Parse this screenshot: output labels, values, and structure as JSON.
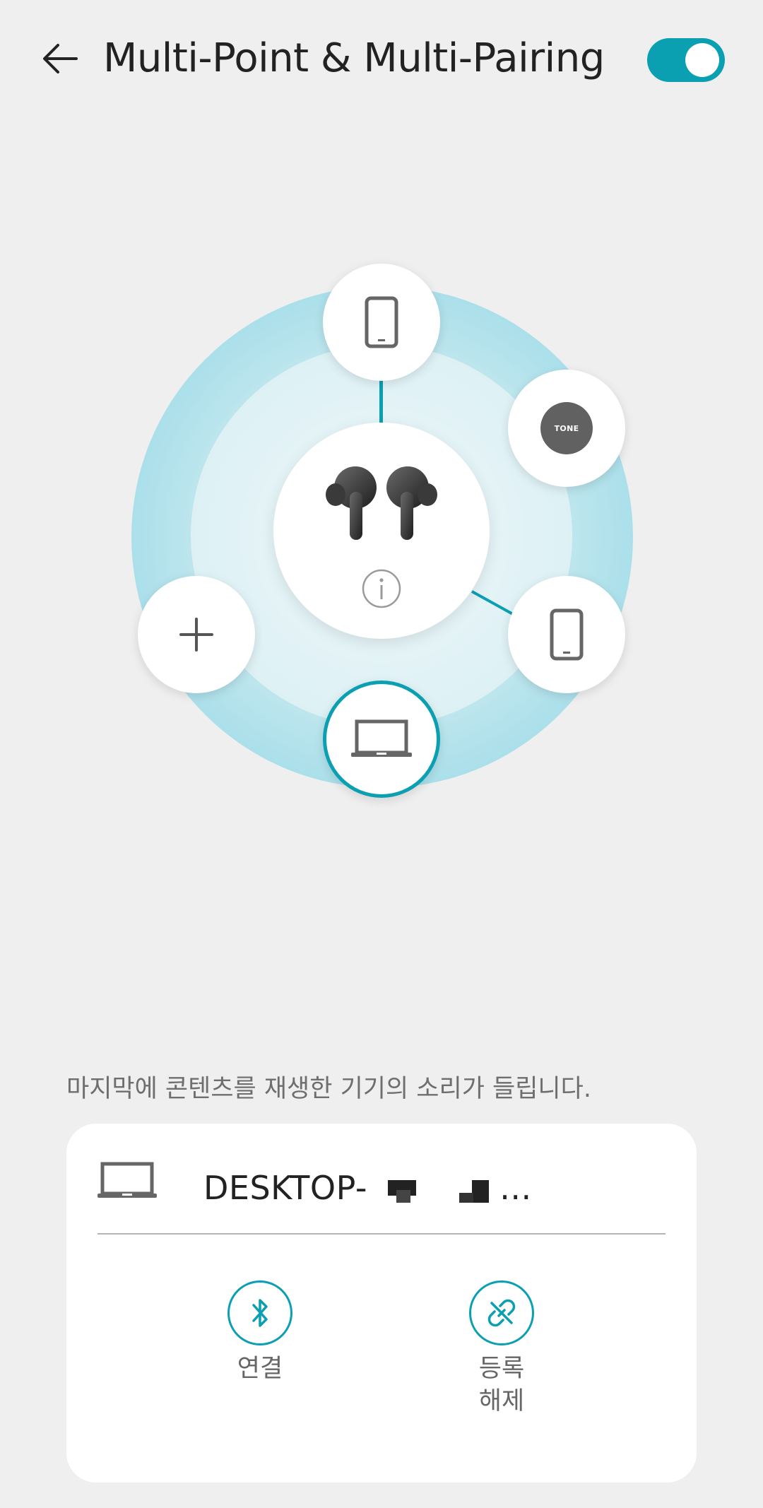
{
  "header": {
    "title": "Multi-Point & Multi-Pairing",
    "back_icon": "arrow-left-icon",
    "toggle_on": true
  },
  "hub": {
    "center": {
      "icon": "earbuds-image",
      "info_icon": "info-icon"
    },
    "nodes": [
      {
        "name": "phone-top",
        "icon": "smartphone-icon"
      },
      {
        "name": "tone-device",
        "icon": "tone-logo",
        "label": "TONE"
      },
      {
        "name": "phone-right",
        "icon": "smartphone-icon"
      },
      {
        "name": "laptop-active",
        "icon": "laptop-icon",
        "active": true
      },
      {
        "name": "add-device",
        "icon": "plus-icon"
      }
    ]
  },
  "hint_text": "마지막에 콘텐츠를 재생한 기기의 소리가 들립니다.",
  "device_card": {
    "icon": "laptop-icon",
    "name": "DESKTOP-",
    "name_suffix": "...",
    "actions": [
      {
        "label": "연결",
        "icon": "bluetooth-icon"
      },
      {
        "label": "등록\n해제",
        "icon": "unlink-icon"
      }
    ]
  },
  "colors": {
    "accent": "#0b9fb2",
    "background": "#efefef"
  }
}
